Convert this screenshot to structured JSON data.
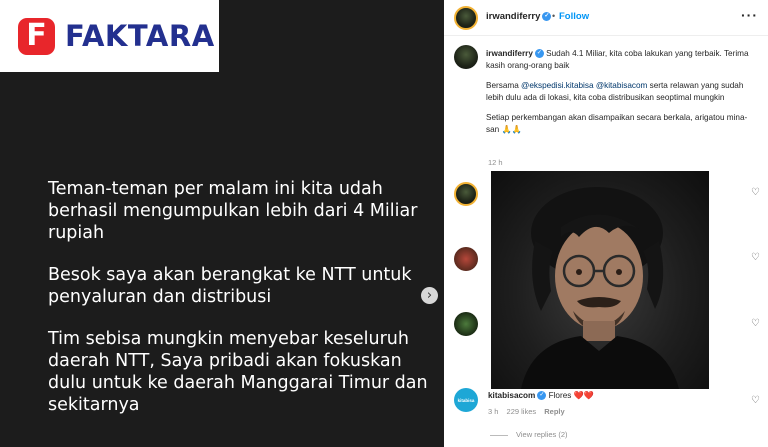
{
  "brand": {
    "logo_letter": "F",
    "name": "FAKTARA",
    "accent_red": "#e8262b",
    "accent_blue": "#23308f"
  },
  "post_slide": {
    "paragraphs": [
      "Teman-teman per malam ini kita udah berhasil mengumpulkan lebih dari 4 Miliar rupiah",
      "Besok saya akan berangkat ke NTT untuk penyaluran dan distribusi",
      "Tim sebisa mungkin menyebar keseluruh daerah NTT, Saya pribadi akan fokuskan dulu untuk ke daerah Manggarai Timur dan sekitarnya"
    ],
    "next_icon": "chevron-right-icon"
  },
  "header": {
    "username": "irwandiferry",
    "dot": "•",
    "follow_label": "Follow",
    "more_icon": "more-horizontal-icon"
  },
  "caption": {
    "username": "irwandiferry",
    "line1": "Sudah 4.1 Miliar, kita coba lakukan yang terbaik. Terima kasih orang-orang baik",
    "line2_prefix": "Bersama ",
    "mention1": "@ekspedisi.kitabisa",
    "mention2": "@kitabisacom",
    "line2_suffix": " serta relawan yang sudah lebih dulu ada di lokasi, kita coba distribusikan seoptimal mungkin",
    "line3": "Setiap perkembangan akan disampaikan secara berkala, arigatou mina-san 🙏🙏",
    "time": "12 h"
  },
  "kitabisa_comment": {
    "avatar_text": "kitabisa",
    "username": "kitabisacom",
    "text": "Flores ❤️❤️",
    "time": "3 h",
    "likes": "229 likes",
    "reply_label": "Reply",
    "view_replies": "View replies (2)"
  }
}
